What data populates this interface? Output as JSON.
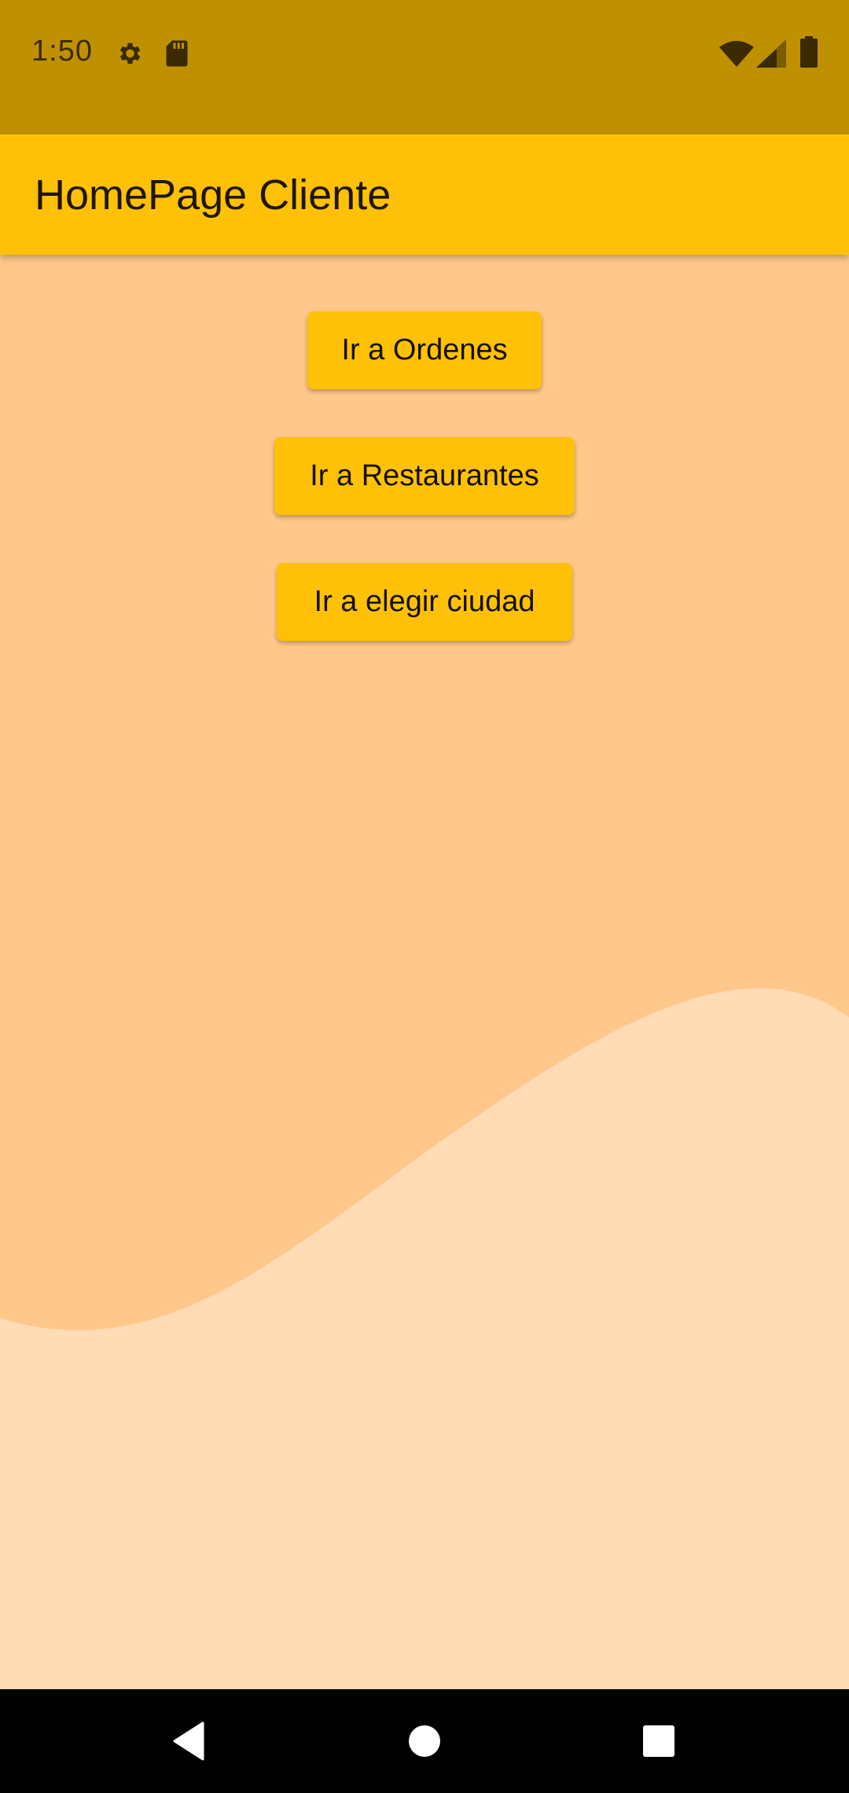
{
  "status_bar": {
    "time": "1:50",
    "icons": [
      "settings-icon",
      "sd-card-icon",
      "wifi-icon",
      "cell-signal-icon",
      "battery-icon"
    ]
  },
  "app_bar": {
    "title": "HomePage Cliente"
  },
  "main": {
    "buttons": [
      {
        "label": "Ir a Ordenes"
      },
      {
        "label": "Ir a Restaurantes"
      },
      {
        "label": "Ir a elegir ciudad"
      }
    ]
  },
  "nav_bar": {
    "icons": [
      "back-icon",
      "home-icon",
      "recents-icon"
    ]
  },
  "colors": {
    "status_bar": "#bf9100",
    "app_bar": "#ffc107",
    "background": "#ffc78a",
    "wave": "#ffdbb6",
    "button": "#ffc107",
    "nav_bar": "#000000"
  }
}
